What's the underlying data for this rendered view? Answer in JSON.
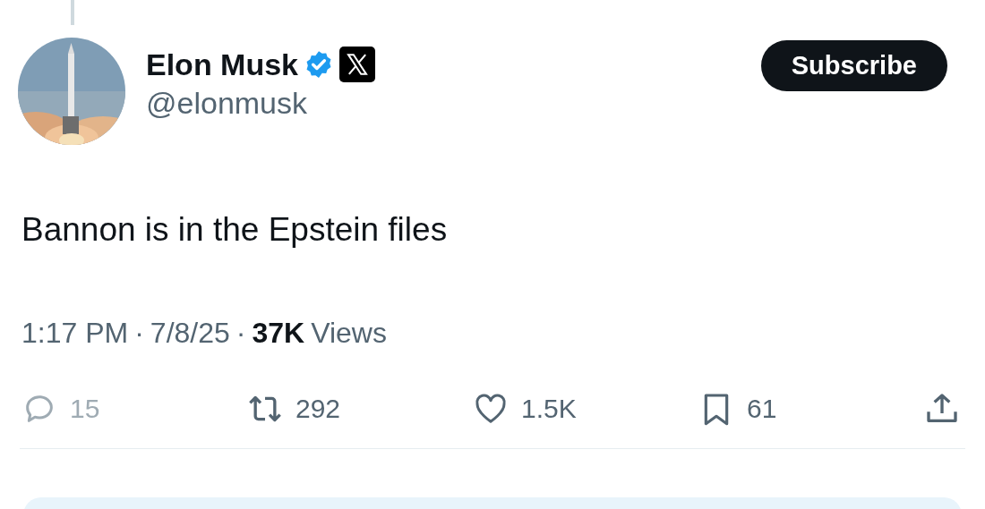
{
  "author": {
    "name": "Elon Musk",
    "verified": true,
    "handle": "@elonmusk"
  },
  "subscribe_button": "Subscribe",
  "post_text": "Bannon is in the Epstein files",
  "meta": {
    "time": "1:17 PM",
    "date": "7/8/25",
    "views_count": "37K",
    "views_label": "Views",
    "separator": "·"
  },
  "actions": [
    {
      "kind": "reply",
      "count": "15",
      "disabled": true
    },
    {
      "kind": "repost",
      "count": "292",
      "disabled": false
    },
    {
      "kind": "like",
      "count": "1.5K",
      "disabled": false
    },
    {
      "kind": "bookmark",
      "count": "61",
      "disabled": false
    },
    {
      "kind": "share",
      "disabled": false
    }
  ]
}
